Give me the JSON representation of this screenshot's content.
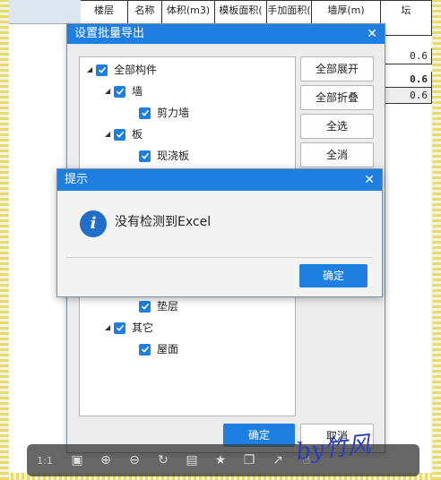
{
  "sheet": {
    "headers": [
      "楼层",
      "名称",
      "体积(m3)",
      "模板面积(",
      "手加面积(",
      "墙厚(m)",
      "坛"
    ],
    "cells": [
      "0.6",
      "0.6",
      "0.6"
    ]
  },
  "main_dialog": {
    "title": "设置批量导出",
    "tree": [
      {
        "label": "全部构件"
      },
      {
        "label": "墙"
      },
      {
        "label": "剪力墙"
      },
      {
        "label": "板"
      },
      {
        "label": "现浇板"
      },
      {
        "label": "垫层"
      },
      {
        "label": "其它"
      },
      {
        "label": "屋面"
      }
    ],
    "buttons": {
      "expand_all": "全部展开",
      "collapse_all": "全部折叠",
      "select_all": "全选",
      "deselect_all": "全消",
      "ok": "确定",
      "cancel": "取消"
    }
  },
  "prompt_dialog": {
    "title": "提示",
    "message": "没有检测到Excel",
    "ok": "确定"
  },
  "toolbar": {
    "ratio": "1:1",
    "icons": [
      "fit-window-icon",
      "zoom-in-icon",
      "zoom-out-icon",
      "rotate-icon",
      "save-icon",
      "favorite-icon",
      "copy-icon",
      "share-icon",
      "like-icon"
    ]
  },
  "watermark": "by竹风"
}
